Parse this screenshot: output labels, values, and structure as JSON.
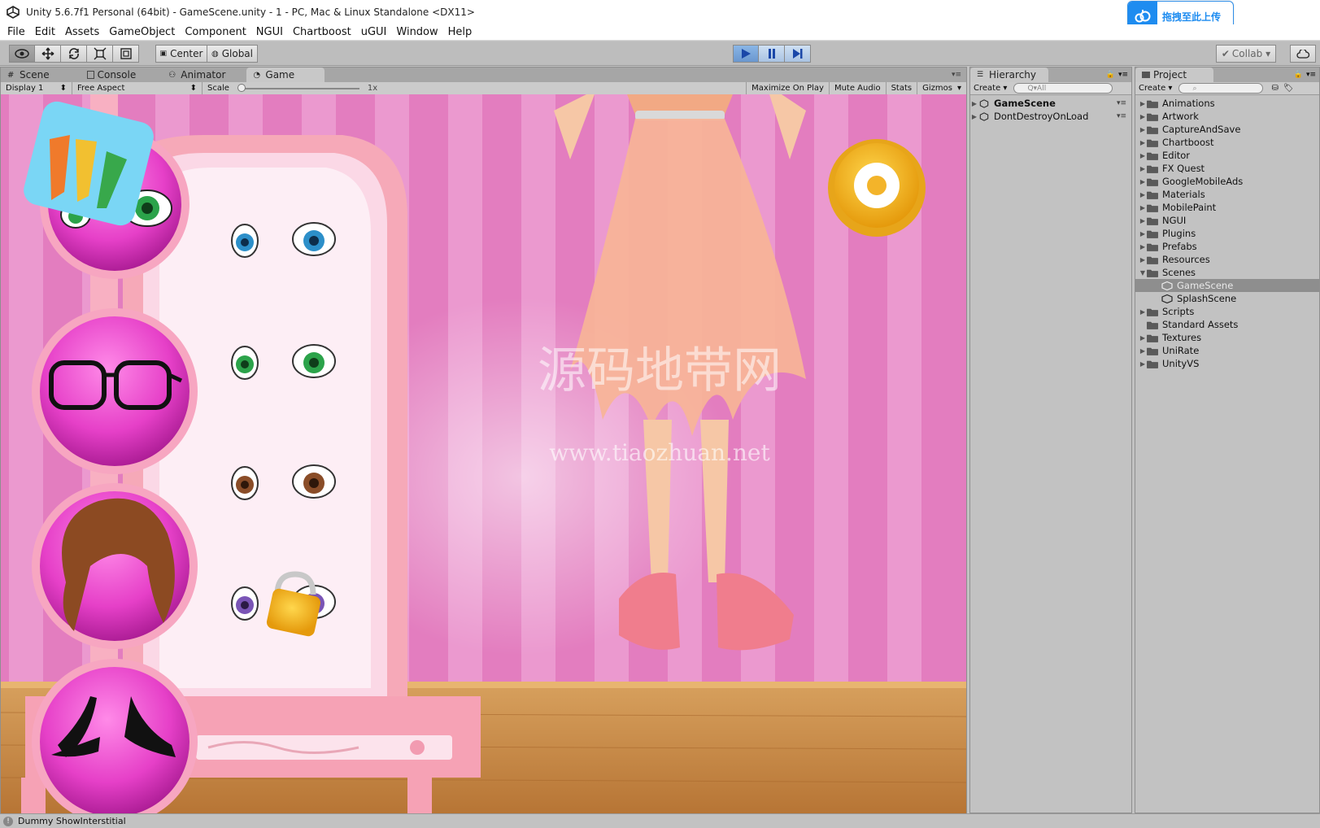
{
  "window": {
    "title": "Unity 5.6.7f1 Personal (64bit) - GameScene.unity - 1 - PC, Mac & Linux Standalone <DX11>"
  },
  "upload_widget": {
    "label": "拖拽至此上传"
  },
  "menu": [
    "File",
    "Edit",
    "Assets",
    "GameObject",
    "Component",
    "NGUI",
    "Chartboost",
    "uGUI",
    "Window",
    "Help"
  ],
  "toolbar": {
    "pivot_label": "Center",
    "space_label": "Global",
    "collab_label": "Collab ▾"
  },
  "game_tabs": [
    {
      "label": "Scene",
      "icon": "scene-icon"
    },
    {
      "label": "Console",
      "icon": "console-icon"
    },
    {
      "label": "Animator",
      "icon": "animator-icon"
    },
    {
      "label": "Game",
      "icon": "game-icon"
    }
  ],
  "game_bar": {
    "display": "Display 1",
    "aspect": "Free Aspect",
    "scale_label": "Scale",
    "scale_value": "1x",
    "maximize": "Maximize On Play",
    "mute": "Mute Audio",
    "stats": "Stats",
    "gizmos": "Gizmos"
  },
  "game_scene": {
    "watermark_cn": "源码地带网",
    "watermark_url": "www.tiaozhuan.net"
  },
  "hierarchy": {
    "tab": "Hierarchy",
    "create": "Create ▾",
    "search_placeholder": "Q▾All",
    "items": [
      {
        "label": "GameScene",
        "bold": true
      },
      {
        "label": "DontDestroyOnLoad",
        "bold": false
      }
    ]
  },
  "project": {
    "tab": "Project",
    "create": "Create ▾",
    "items": [
      {
        "label": "Animations",
        "type": "folder"
      },
      {
        "label": "Artwork",
        "type": "folder"
      },
      {
        "label": "CaptureAndSave",
        "type": "folder"
      },
      {
        "label": "Chartboost",
        "type": "folder"
      },
      {
        "label": "Editor",
        "type": "folder"
      },
      {
        "label": "FX Quest",
        "type": "folder"
      },
      {
        "label": "GoogleMobileAds",
        "type": "folder"
      },
      {
        "label": "Materials",
        "type": "folder"
      },
      {
        "label": "MobilePaint",
        "type": "folder"
      },
      {
        "label": "NGUI",
        "type": "folder"
      },
      {
        "label": "Plugins",
        "type": "folder"
      },
      {
        "label": "Prefabs",
        "type": "folder"
      },
      {
        "label": "Resources",
        "type": "folder"
      },
      {
        "label": "Scenes",
        "type": "folder-open"
      },
      {
        "label": "GameScene",
        "type": "scene",
        "selected": true
      },
      {
        "label": "SplashScene",
        "type": "scene"
      },
      {
        "label": "Scripts",
        "type": "folder"
      },
      {
        "label": "Standard Assets",
        "type": "folder-noarrow"
      },
      {
        "label": "Textures",
        "type": "folder"
      },
      {
        "label": "UniRate",
        "type": "folder"
      },
      {
        "label": "UnityVS",
        "type": "folder"
      }
    ]
  },
  "status": {
    "message": "Dummy ShowInterstitial"
  },
  "colors": {
    "play_blue": "#6a97cf",
    "wall_pink": "#e37dbf",
    "floor_wood": "#c98a4a"
  }
}
